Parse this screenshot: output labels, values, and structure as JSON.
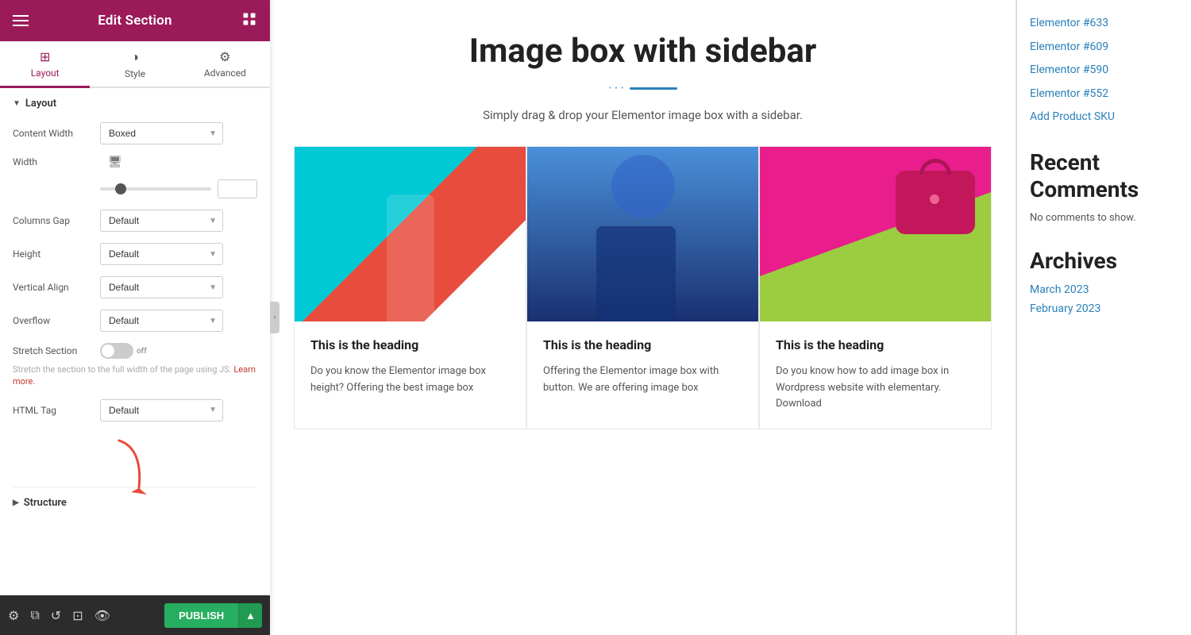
{
  "header": {
    "title": "Edit Section",
    "hamburger_label": "menu",
    "grid_label": "apps"
  },
  "tabs": [
    {
      "id": "layout",
      "label": "Layout",
      "icon": "⊞",
      "active": true
    },
    {
      "id": "style",
      "label": "Style",
      "icon": "◑",
      "active": false
    },
    {
      "id": "advanced",
      "label": "Advanced",
      "icon": "⚙",
      "active": false
    }
  ],
  "layout_section": {
    "title": "Layout",
    "fields": {
      "content_width": {
        "label": "Content Width",
        "value": "Boxed"
      },
      "width": {
        "label": "Width",
        "slider_value": 15
      },
      "columns_gap": {
        "label": "Columns Gap",
        "value": "Default"
      },
      "height": {
        "label": "Height",
        "value": "Default"
      },
      "vertical_align": {
        "label": "Vertical Align",
        "value": "Default"
      },
      "overflow": {
        "label": "Overflow",
        "value": "Default"
      },
      "stretch_section": {
        "label": "Stretch Section",
        "value": "off",
        "description": "Stretch the section to the full width of the page using JS.",
        "learn_more": "Learn more."
      },
      "html_tag": {
        "label": "HTML Tag",
        "value": "Default"
      }
    }
  },
  "structure_section": {
    "title": "Structure"
  },
  "bottom_toolbar": {
    "publish_label": "PUBLISH"
  },
  "main": {
    "title": "Image box with sidebar",
    "subtitle": "Simply drag & drop your Elementor image box with a sidebar.",
    "image_boxes": [
      {
        "heading": "This is the heading",
        "text": "Do you know the Elementor image box height? Offering the best image box"
      },
      {
        "heading": "This is the heading",
        "text": "Offering the Elementor image box with button. We are offering image box"
      },
      {
        "heading": "This is the heading",
        "text": "Do you know how to add image box in Wordpress website with elementary. Download"
      }
    ]
  },
  "right_sidebar": {
    "links": [
      {
        "label": "Elementor #633"
      },
      {
        "label": "Elementor #609"
      },
      {
        "label": "Elementor #590"
      },
      {
        "label": "Elementor #552"
      },
      {
        "label": "Add Product SKU"
      }
    ],
    "recent_comments_title": "Recent Comments",
    "no_comments_text": "No comments to show.",
    "archives_title": "Archives",
    "archive_links": [
      {
        "label": "March 2023"
      },
      {
        "label": "February 2023"
      }
    ]
  }
}
